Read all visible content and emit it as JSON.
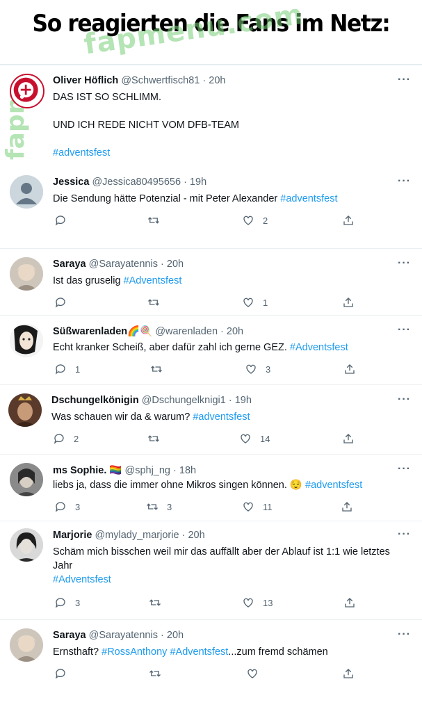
{
  "page": {
    "headline": "So reagierten die Fans im Netz:",
    "watermark_text": "fapmenu.com",
    "watermark_side": "fapm"
  },
  "colors": {
    "link": "#1d9bf0",
    "muted": "#536471",
    "text": "#0f1419",
    "club_red": "#c8102e"
  },
  "icons": [
    "reply-icon",
    "retweet-icon",
    "like-icon",
    "share-icon",
    "more-icon"
  ],
  "tweets": [
    {
      "name": "Oliver Höflich",
      "handle": "@Schwertfisch81",
      "dot": "·",
      "time": "20h",
      "more": "···",
      "lines": [
        "DAS IST SO SCHLIMM.",
        "UND ICH REDE NICHT VOM DFB-TEAM"
      ],
      "hashtag": "#adventsfest"
    },
    {
      "name": "Jessica",
      "handle": "@Jessica80495656",
      "dot": "·",
      "time": "19h",
      "more": "···",
      "text": "Die Sendung hätte Potenzial - mit Peter Alexander ",
      "hashtag": "#adventsfest",
      "replies": "",
      "retweets": "",
      "likes": "2"
    },
    {
      "name": "Saraya",
      "handle": "@Sarayatennis",
      "dot": "·",
      "time": "20h",
      "more": "···",
      "text": "Ist das gruselig ",
      "hashtag": "#Adventsfest",
      "replies": "",
      "retweets": "",
      "likes": "1"
    },
    {
      "name": "Süßwarenladen",
      "name_emoji": "🌈🍭",
      "handle": "@warenladen",
      "dot": "·",
      "time": "20h",
      "more": "···",
      "text": "Echt kranker Scheiß, aber dafür zahl ich gerne GEZ. ",
      "hashtag": "#Adventsfest",
      "replies": "1",
      "retweets": "",
      "likes": "3"
    },
    {
      "name": "Dschungelkönigin",
      "handle": "@Dschungelknigi1",
      "dot": "·",
      "time": "19h",
      "more": "···",
      "text": "Was schauen wir da & warum? ",
      "hashtag": "#adventsfest",
      "replies": "2",
      "retweets": "",
      "likes": "14"
    },
    {
      "name": "ms Sophie.",
      "name_emoji": "🏳️‍🌈",
      "handle": "@sphj_ng",
      "dot": "·",
      "time": "18h",
      "more": "···",
      "text": "liebs ja, dass die immer ohne Mikros singen können. ",
      "emoji": "😌",
      "hashtag": "#adventsfest",
      "replies": "3",
      "retweets": "3",
      "likes": "11"
    },
    {
      "name": "Marjorie",
      "handle": "@mylady_marjorie",
      "dot": "·",
      "time": "20h",
      "more": "···",
      "lines": [
        "Schäm mich bisschen weil mir das auffällt aber der Ablauf ist 1:1 wie letztes",
        "Jahr"
      ],
      "hashtag": "#Adventsfest",
      "replies": "3",
      "retweets": "",
      "likes": "13"
    },
    {
      "name": "Saraya",
      "handle": "@Sarayatennis",
      "dot": "·",
      "time": "20h",
      "more": "···",
      "text": "Ernsthaft? ",
      "hashtag": "#RossAnthony",
      "hashtag2": "#Adventsfest",
      "text_after": "...zum fremd schämen",
      "replies": "",
      "retweets": "",
      "likes": ""
    }
  ]
}
